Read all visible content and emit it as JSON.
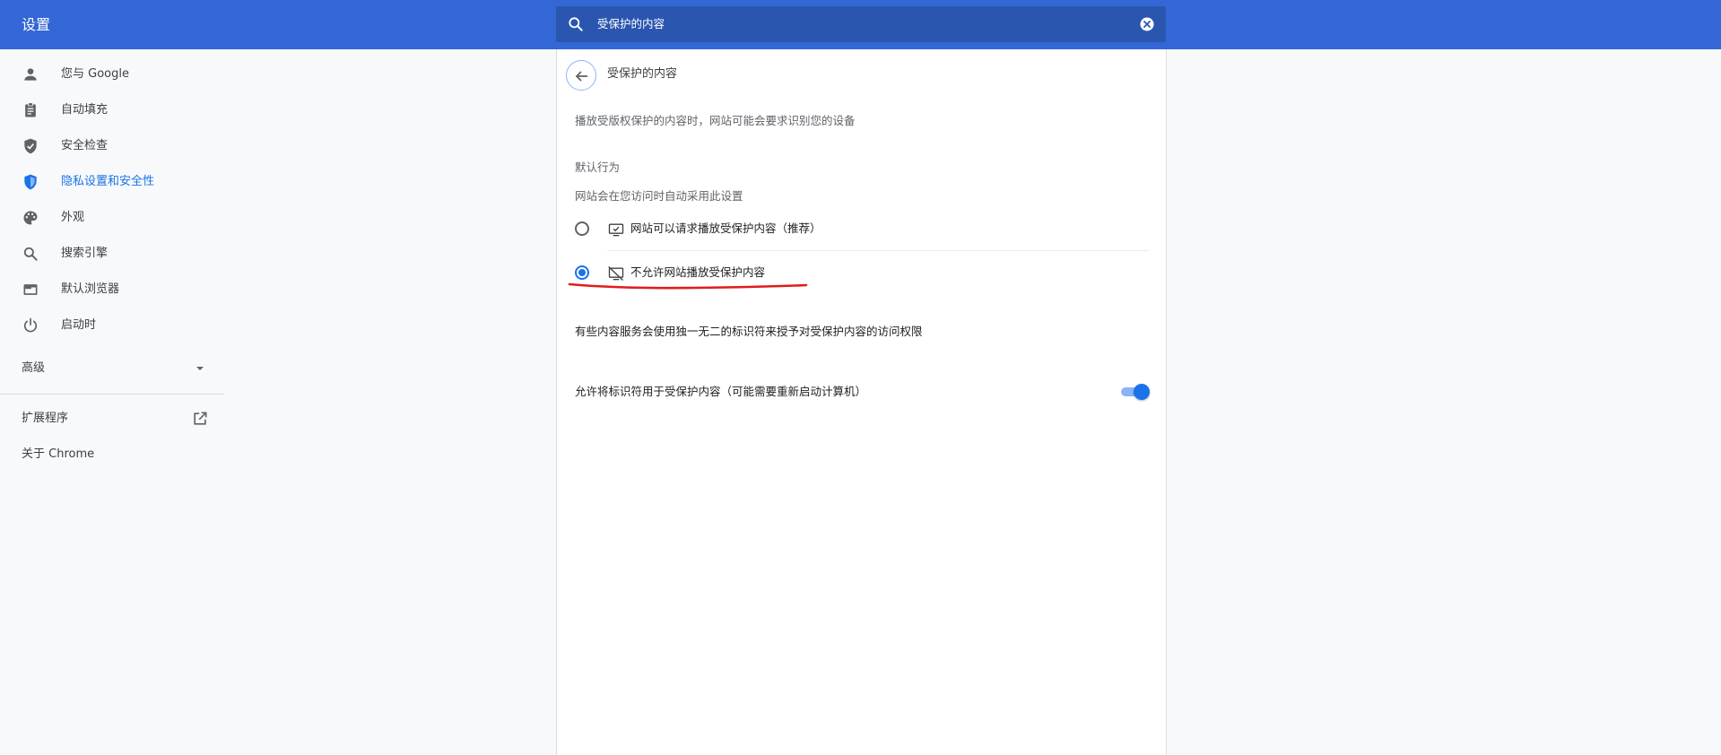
{
  "header": {
    "title": "设置",
    "search": {
      "value": "受保护的内容",
      "icon": "search-icon",
      "clear_icon": "clear-icon"
    }
  },
  "sidebar": {
    "items": [
      {
        "label": "您与 Google",
        "icon": "person-icon"
      },
      {
        "label": "自动填充",
        "icon": "clipboard-icon"
      },
      {
        "label": "安全检查",
        "icon": "shield-check-icon"
      },
      {
        "label": "隐私设置和安全性",
        "icon": "shield-icon",
        "active": true
      },
      {
        "label": "外观",
        "icon": "palette-icon"
      },
      {
        "label": "搜索引擎",
        "icon": "search-icon"
      },
      {
        "label": "默认浏览器",
        "icon": "browser-icon"
      },
      {
        "label": "启动时",
        "icon": "power-icon"
      }
    ],
    "advanced_label": "高级",
    "extensions_label": "扩展程序",
    "about_label": "关于 Chrome"
  },
  "content": {
    "page_title": "受保护的内容",
    "description": "播放受版权保护的内容时，网站可能会要求识别您的设备",
    "default_behavior_label": "默认行为",
    "default_behavior_sub": "网站会在您访问时自动采用此设置",
    "options": [
      {
        "label": "网站可以请求播放受保护内容（推荐）",
        "icon": "monitor-check-icon",
        "checked": false
      },
      {
        "label": "不允许网站播放受保护内容",
        "icon": "monitor-off-icon",
        "checked": true
      }
    ],
    "identifier_info": "有些内容服务会使用独一无二的标识符来授予对受保护内容的访问权限",
    "toggle": {
      "label": "允许将标识符用于受保护内容（可能需要重新启动计算机）",
      "enabled": true
    }
  },
  "colors": {
    "header_bg": "#3367d6",
    "search_bg": "#2a56b0",
    "accent": "#1a73e8",
    "annotation": "#e21b1b"
  }
}
